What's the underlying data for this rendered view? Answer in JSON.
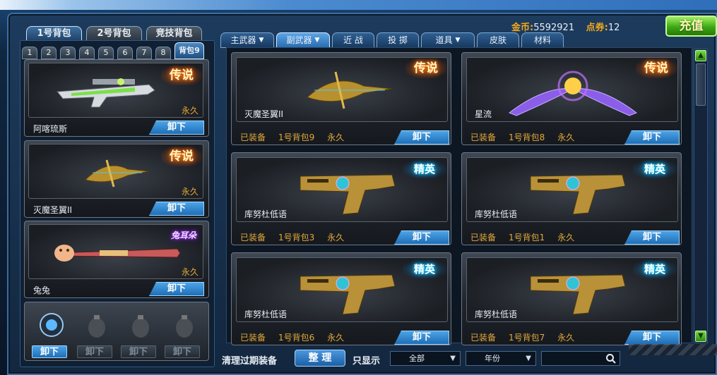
{
  "currency": {
    "gold_label": "金币:",
    "gold_value": "5592921",
    "points_label": "点券:",
    "points_value": "12"
  },
  "recharge_label": "充值",
  "bag_tabs": [
    "1号背包",
    "2号背包",
    "竞技背包"
  ],
  "slot_tabs": [
    "1",
    "2",
    "3",
    "4",
    "5",
    "6",
    "7",
    "8",
    "背包9"
  ],
  "left_items": [
    {
      "name": "阿喀琉斯",
      "permanence": "永久",
      "tag": "传说",
      "action": "卸下"
    },
    {
      "name": "灭魔圣翼II",
      "permanence": "永久",
      "tag": "传说",
      "action": "卸下"
    },
    {
      "name": "兔兔",
      "permanence": "永久",
      "tag": "兔耳朵",
      "action": "卸下"
    }
  ],
  "grenade_buttons": [
    "卸下",
    "卸下",
    "卸下",
    "卸下"
  ],
  "category_tabs": [
    {
      "label": "主武器",
      "dropdown": true
    },
    {
      "label": "副武器",
      "dropdown": true
    },
    {
      "label": "近 战",
      "dropdown": false
    },
    {
      "label": "投 掷",
      "dropdown": false
    },
    {
      "label": "道具",
      "dropdown": true
    },
    {
      "label": "皮肤",
      "dropdown": false
    },
    {
      "label": "材料",
      "dropdown": false
    }
  ],
  "cards": [
    {
      "name": "灭魔圣翼II",
      "status": "已装备",
      "bag": "1号背包9",
      "permanence": "永久",
      "tag": "传说",
      "action": "卸下"
    },
    {
      "name": "星流",
      "status": "已装备",
      "bag": "1号背包8",
      "permanence": "永久",
      "tag": "传说",
      "action": "卸下"
    },
    {
      "name": "库努杜低语",
      "status": "已装备",
      "bag": "1号背包3",
      "permanence": "永久",
      "tag": "精英",
      "action": "卸下"
    },
    {
      "name": "库努杜低语",
      "status": "已装备",
      "bag": "1号背包1",
      "permanence": "永久",
      "tag": "精英",
      "action": "卸下"
    },
    {
      "name": "库努杜低语",
      "status": "已装备",
      "bag": "1号背包6",
      "permanence": "永久",
      "tag": "精英",
      "action": "卸下"
    },
    {
      "name": "库努杜低语",
      "status": "已装备",
      "bag": "1号背包7",
      "permanence": "永久",
      "tag": "精英",
      "action": "卸下"
    }
  ],
  "bottom": {
    "clear_label": "清理过期装备",
    "sort_label": "整 理",
    "show_only_label": "只显示",
    "filter_all": "全部",
    "filter_year": "年份",
    "search_placeholder": ""
  },
  "colors": {
    "gold": "#f4a91b",
    "legend_glow": "#ff7a00",
    "elite_glow": "#00d8ff",
    "action_blue": "#1f6eb5"
  }
}
